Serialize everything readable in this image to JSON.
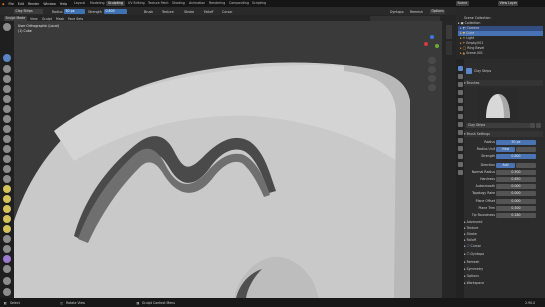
{
  "topbar": {
    "menus": [
      "File",
      "Edit",
      "Render",
      "Window",
      "Help"
    ],
    "workspaces": [
      "Layout",
      "Modeling",
      "Sculpting",
      "UV Editing",
      "Texture Paint",
      "Shading",
      "Animation",
      "Rendering",
      "Compositing",
      "Scripting"
    ],
    "active_workspace": "Sculpting",
    "scene": "Scene",
    "view_layer": "View Layer"
  },
  "header": {
    "mode": "Clay Strips",
    "radius_label": "Radius",
    "radius_value": "50 px",
    "strength_label": "Strength",
    "strength_value": "0.800",
    "menus": [
      "Brush",
      "Texture",
      "Stroke",
      "Falloff",
      "Cursor"
    ],
    "options_label": "Options",
    "right_items": [
      "Dyntopo",
      "Remesh"
    ],
    "sub_menus": [
      "Sculpt Mode",
      "View",
      "Sculpt",
      "Mask",
      "Face Sets"
    ]
  },
  "viewport": {
    "title": "User Orthographic (Local)",
    "subtitle": "(1) Cube",
    "gizmo_labels": [
      "X",
      "Y",
      "Z"
    ],
    "colors": {
      "background": "#3a3a3a",
      "mesh": "#c8c8c8",
      "shadow": "#4a4a4a"
    }
  },
  "outliner": {
    "header": "Scene Collection",
    "rows": [
      {
        "label": "Collection",
        "selected": false
      },
      {
        "label": "Camera",
        "selected": false
      },
      {
        "label": "Cube",
        "selected": true
      },
      {
        "label": "Light",
        "selected": false
      },
      {
        "label": "Empty.001",
        "selected": false
      },
      {
        "label": "Ring Bevel",
        "selected": false
      },
      {
        "label": "Scene.001",
        "selected": false
      }
    ]
  },
  "properties": {
    "tool_title": "Clay Strips",
    "brushes_label": "Brushes",
    "brush_name": "Clay Strips",
    "brush_settings_label": "Brush Settings",
    "rows": [
      {
        "label": "Radius",
        "value": "50 px",
        "blue": true
      },
      {
        "label": "Radius Unit",
        "value": "View",
        "blue": true
      },
      {
        "label": "Strength",
        "value": "0.800",
        "blue": true
      },
      {
        "label": "Direction",
        "value": "Add",
        "blue": true
      },
      {
        "label": "Normal Radius",
        "value": "0.500",
        "blue": false
      },
      {
        "label": "Hardness",
        "value": "0.650",
        "blue": false
      },
      {
        "label": "Autosmooth",
        "value": "0.000",
        "blue": false
      },
      {
        "label": "Topology Rake",
        "value": "0.000",
        "blue": false
      },
      {
        "label": "Plane Offset",
        "value": "0.000",
        "blue": false
      },
      {
        "label": "Plane Trim",
        "value": "0.500",
        "blue": false
      },
      {
        "label": "Tip Roundness",
        "value": "0.180",
        "blue": false
      }
    ],
    "subpanels": [
      "Advanced",
      "Texture",
      "Stroke",
      "Falloff",
      "Cursor",
      "Dyntopo",
      "Remesh",
      "Symmetry",
      "Options",
      "Workspace"
    ]
  },
  "status": {
    "left": "Select",
    "middle": "Rotate View",
    "right_action": "Sculpt Context Menu",
    "version": "2.90.0"
  }
}
